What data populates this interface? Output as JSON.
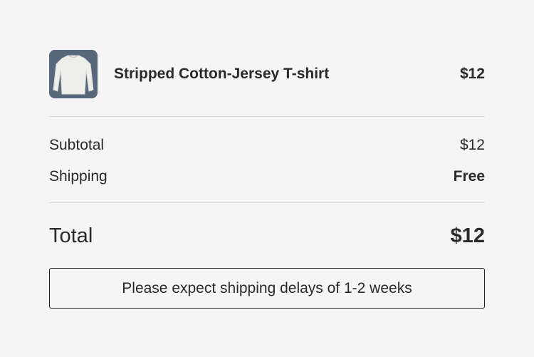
{
  "item": {
    "name": "Stripped Cotton-Jersey T-shirt",
    "price": "$12",
    "image_icon": "white-long-sleeve-shirt-image"
  },
  "summary": {
    "subtotal_label": "Subtotal",
    "subtotal_value": "$12",
    "shipping_label": "Shipping",
    "shipping_value": "Free",
    "total_label": "Total",
    "total_value": "$12"
  },
  "notice": {
    "text": "Please expect shipping delays of 1-2 weeks"
  },
  "colors": {
    "background": "#f5f5f5",
    "thumbnail_background": "#56677c",
    "text": "#2a2a2a",
    "divider": "#dcdcdc",
    "notice_border": "#222222"
  }
}
